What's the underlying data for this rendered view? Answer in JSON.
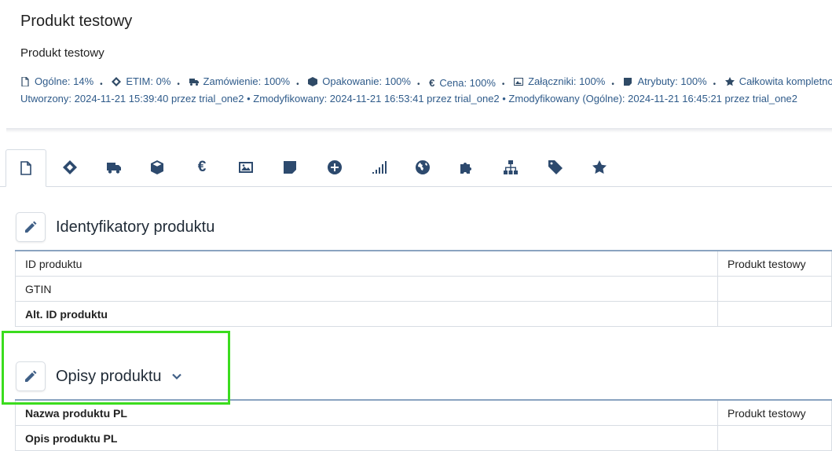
{
  "header": {
    "title": "Produkt testowy",
    "subtitle": "Produkt testowy",
    "stats": [
      {
        "icon": "file-icon",
        "label": "Ogólne: 14%"
      },
      {
        "icon": "etim-icon",
        "label": "ETIM: 0%"
      },
      {
        "icon": "truck-icon",
        "label": "Zamówienie: 100%"
      },
      {
        "icon": "box-icon",
        "label": "Opakowanie: 100%"
      },
      {
        "icon": "euro-icon",
        "label": "Cena: 100%"
      },
      {
        "icon": "image-icon",
        "label": "Załączniki: 100%"
      },
      {
        "icon": "note-icon",
        "label": "Atrybuty: 100%"
      },
      {
        "icon": "star-icon",
        "label": "Całkowita kompletność"
      }
    ],
    "meta": "Utworzony: 2024-11-21 15:39:40 przez trial_one2  •  Zmodyfikowany: 2024-11-21 16:53:41 przez trial_one2  •  Zmodyfikowany (Ogólne): 2024-11-21 16:45:21 przez trial_one2"
  },
  "tabs": [
    "file-icon",
    "etim-icon",
    "truck-icon",
    "box-icon",
    "euro-icon",
    "image-icon",
    "note-icon",
    "plus-circle-icon",
    "signal-icon",
    "globe-icon",
    "puzzle-icon",
    "sitemap-icon",
    "tag-icon",
    "star-icon"
  ],
  "sections": {
    "identifiers": {
      "title": "Identyfikatory produktu",
      "rows": [
        {
          "key": "ID produktu",
          "value": "Produkt testowy",
          "bold": false
        },
        {
          "key": "GTIN",
          "value": "",
          "bold": false
        },
        {
          "key": "Alt. ID produktu",
          "value": "",
          "bold": true
        }
      ]
    },
    "descriptions": {
      "title": "Opisy produktu",
      "rows": [
        {
          "key": "Nazwa produktu PL",
          "value": "Produkt testowy",
          "bold": true
        },
        {
          "key": "Opis produktu PL",
          "value": "",
          "bold": true
        }
      ]
    }
  },
  "colors": {
    "accent": "#2d4a6e",
    "link": "#2f5b8a",
    "highlight": "#3bdc1e"
  }
}
